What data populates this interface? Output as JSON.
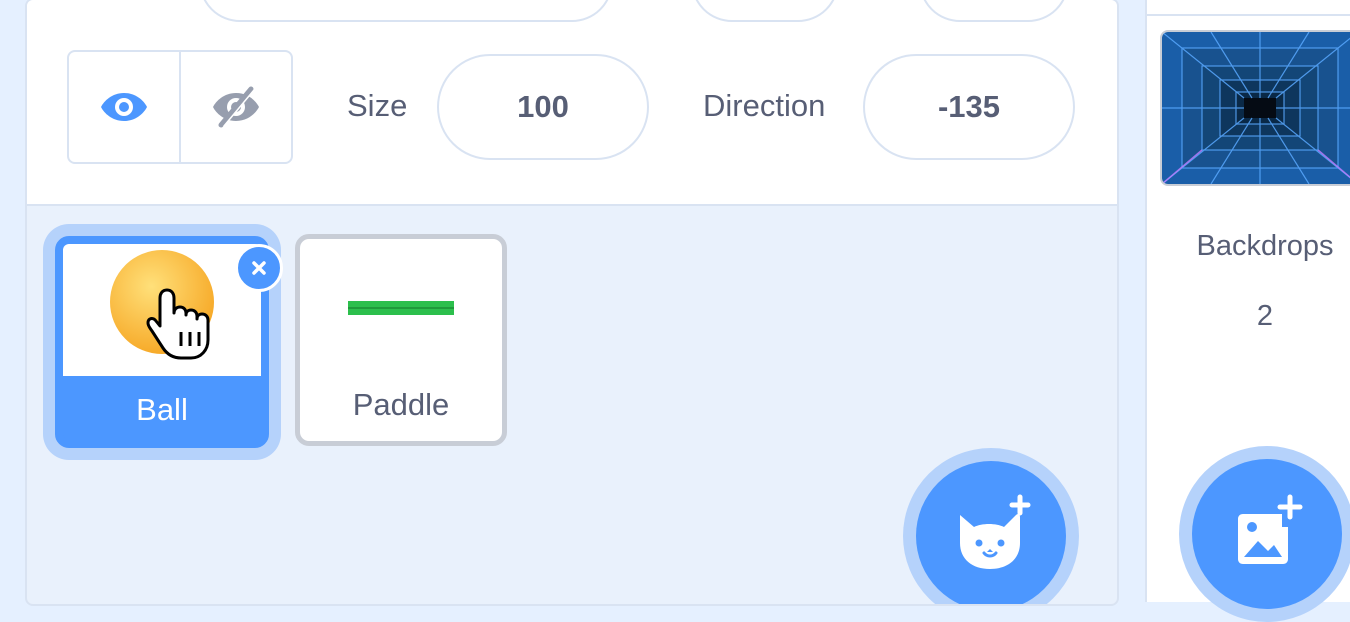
{
  "sprite_info": {
    "size_label": "Size",
    "size_value": "100",
    "direction_label": "Direction",
    "direction_value": "-135",
    "show_icon": "eye-icon",
    "hide_icon": "eye-slash-icon"
  },
  "sprites": [
    {
      "name": "Ball",
      "selected": true
    },
    {
      "name": "Paddle",
      "selected": false
    }
  ],
  "stage": {
    "backdrops_label": "Backdrops",
    "backdrops_count": "2"
  },
  "icons": {
    "add_sprite": "cat-plus-icon",
    "add_backdrop": "image-plus-icon",
    "delete": "close-icon",
    "cursor": "hand-pointer-icon"
  },
  "colors": {
    "accent": "#4c97ff",
    "accent_light": "#b5d2fb",
    "text": "#575e75",
    "pane_bg": "#e9f1fc",
    "paddle": "#2cbf4c"
  }
}
